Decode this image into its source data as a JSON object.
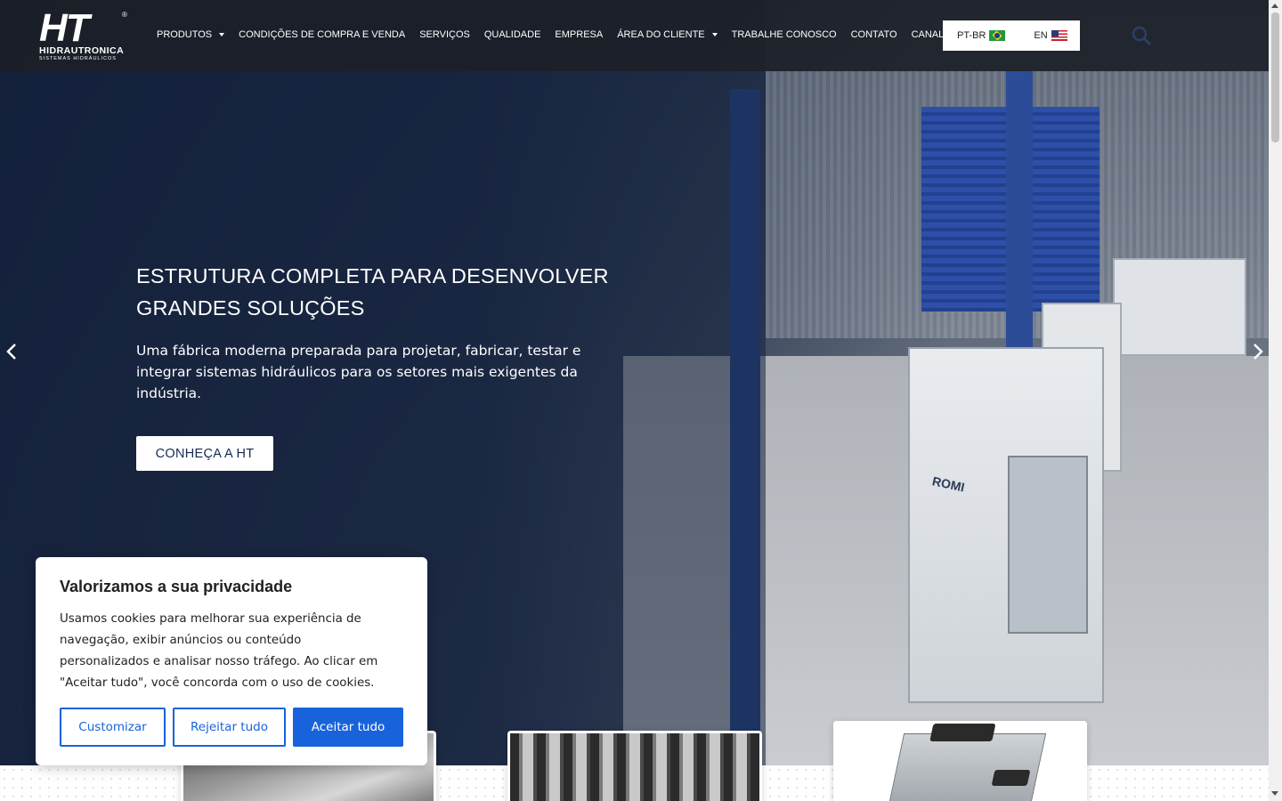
{
  "header": {
    "logo": {
      "mark": "HT",
      "registered": "®",
      "name": "HIDRAUTRONICA",
      "subtitle": "SISTEMAS HIDRÁULICOS"
    },
    "nav": [
      {
        "label": "PRODUTOS",
        "has_dropdown": true
      },
      {
        "label": "CONDIÇÕES DE COMPRA E VENDA",
        "has_dropdown": false
      },
      {
        "label": "SERVIÇOS",
        "has_dropdown": false
      },
      {
        "label": "QUALIDADE",
        "has_dropdown": false
      },
      {
        "label": "EMPRESA",
        "has_dropdown": false
      },
      {
        "label": "ÁREA DO CLIENTE",
        "has_dropdown": true
      },
      {
        "label": "TRABALHE CONOSCO",
        "has_dropdown": false
      },
      {
        "label": "CONTATO",
        "has_dropdown": false
      },
      {
        "label": "CANAL DE DENÚNCIAS",
        "has_dropdown": false
      }
    ],
    "languages": [
      {
        "code": "PT-BR",
        "flag": "brazil-flag-icon"
      },
      {
        "code": "EN",
        "flag": "us-flag-icon"
      }
    ],
    "search_icon": "search-icon"
  },
  "hero": {
    "title_line1": "ESTRUTURA COMPLETA PARA DESENVOLVER",
    "title_line2": "GRANDES SOLUÇÕES",
    "text": "Uma fábrica moderna preparada para projetar, fabricar, testar e integrar sistemas hidráulicos para os setores mais exigentes da indústria.",
    "cta_label": "CONHEÇA A HT",
    "machine_brand": "ROMI",
    "prev_icon": "chevron-left-icon",
    "next_icon": "chevron-right-icon"
  },
  "cookie": {
    "title": "Valorizamos a sua privacidade",
    "text": "Usamos cookies para melhorar sua experiência de navegação, exibir anúncios ou conteúdo personalizados e analisar nosso tráfego. Ao clicar em \"Aceitar tudo\", você concorda com o uso de cookies.",
    "customize_label": "Customizar",
    "reject_label": "Rejeitar tudo",
    "accept_label": "Aceitar tudo"
  },
  "colors": {
    "accent_blue": "#1863dc",
    "hero_overlay": "#14203a",
    "header_bg": "#1c1e24",
    "cta_text": "#152a52"
  }
}
